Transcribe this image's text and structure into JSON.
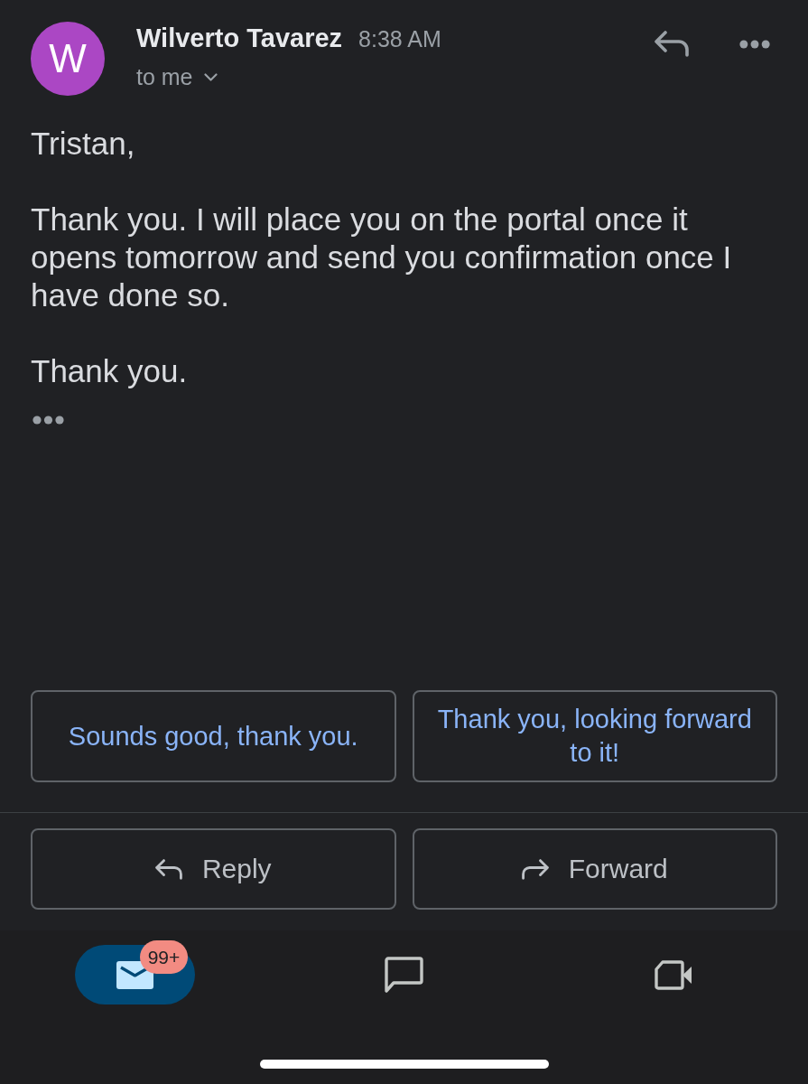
{
  "header": {
    "avatar_letter": "W",
    "sender": "Wilverto Tavarez",
    "time": "8:38 AM",
    "recipient": "to me"
  },
  "body": {
    "paragraphs": [
      "Tristan,",
      "Thank you. I will place you on the portal once it opens tomorrow and send you confirmation once I have done so.",
      "Thank you."
    ]
  },
  "smart_replies": [
    "Sounds good, thank you.",
    "Thank you, looking forward to it!"
  ],
  "actions": [
    {
      "kind": "reply",
      "label": "Reply"
    },
    {
      "kind": "forward",
      "label": "Forward"
    }
  ],
  "bottom_nav": [
    {
      "kind": "mail",
      "selected": true,
      "badge": "99+"
    },
    {
      "kind": "chat",
      "selected": false
    },
    {
      "kind": "video",
      "selected": false
    }
  ]
}
